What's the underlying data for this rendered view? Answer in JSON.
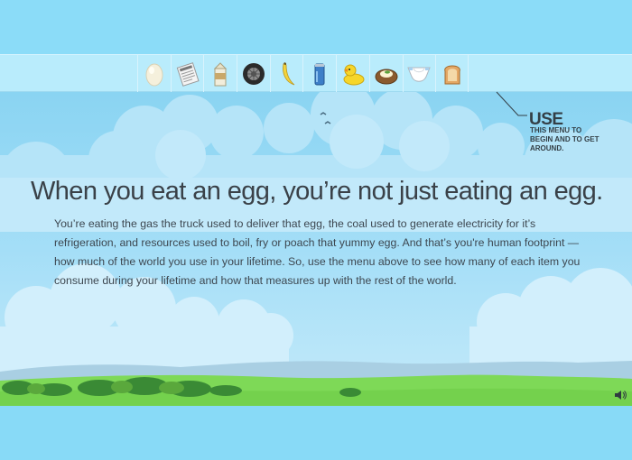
{
  "menu": {
    "items": [
      {
        "name": "egg"
      },
      {
        "name": "newspaper"
      },
      {
        "name": "milk-carton"
      },
      {
        "name": "tire"
      },
      {
        "name": "banana"
      },
      {
        "name": "soda-can"
      },
      {
        "name": "rubber-duck"
      },
      {
        "name": "baked-potato"
      },
      {
        "name": "diaper"
      },
      {
        "name": "toast"
      }
    ]
  },
  "callout": {
    "title": "USE",
    "subtitle": "THIS MENU TO BEGIN AND TO GET AROUND."
  },
  "headline": "When you eat an egg, you’re not just eating an egg.",
  "body": "You’re eating the gas the truck used to deliver that egg, the coal used to generate electricity for it’s refrigeration, and resources used to boil, fry or poach that yummy egg. And that’s you're human footprint — how much of the world you use in your lifetime. So, use the menu above to see how many of each item you consume during your lifetime and how that measures up with the rest of the world.",
  "colors": {
    "sky": "#88daf7",
    "menu_bar": "#b9ecfc",
    "grass": "#7ed957",
    "text": "#3a4148"
  }
}
